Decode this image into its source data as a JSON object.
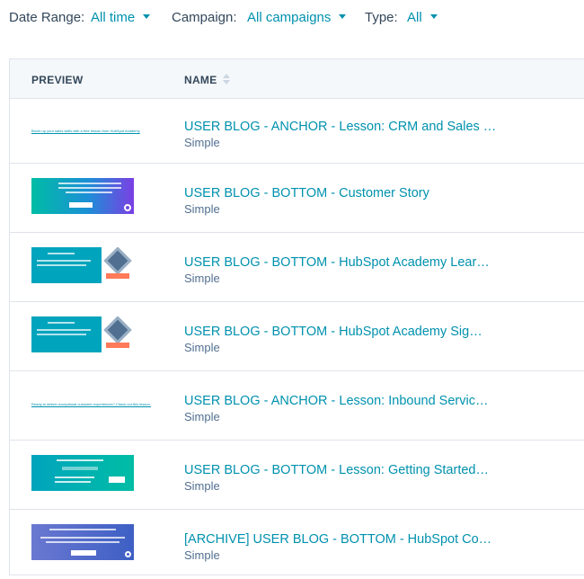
{
  "filters": {
    "date_range": {
      "label": "Date Range:",
      "value": "All time"
    },
    "campaign": {
      "label": "Campaign:",
      "value": "All campaigns"
    },
    "type": {
      "label": "Type:",
      "value": "All"
    }
  },
  "table": {
    "columns": {
      "preview": "PREVIEW",
      "name": "NAME"
    },
    "rows": [
      {
        "name": "USER BLOG - ANCHOR - Lesson: CRM and Sales …",
        "type": "Simple",
        "preview_text": "Brush up your sales skills with a free lesson from HubSpot Academy"
      },
      {
        "name": "USER BLOG - BOTTOM - Customer Story",
        "type": "Simple"
      },
      {
        "name": "USER BLOG - BOTTOM - HubSpot Academy Lear…",
        "type": "Simple"
      },
      {
        "name": "USER BLOG - BOTTOM - HubSpot Academy Sig…",
        "type": "Simple"
      },
      {
        "name": "USER BLOG - ANCHOR - Lesson: Inbound Servic…",
        "type": "Simple",
        "preview_text": "Ready to deliver exceptional customer experiences? Check out this lesson."
      },
      {
        "name": "USER BLOG - BOTTOM - Lesson: Getting Started…",
        "type": "Simple"
      },
      {
        "name": "[ARCHIVE] USER BLOG - BOTTOM - HubSpot Co…",
        "type": "Simple"
      }
    ]
  },
  "colors": {
    "link": "#0091ae",
    "text": "#33475b",
    "header_bg": "#f5f8fa",
    "border": "#dfe3eb"
  },
  "icons": [
    "chevron-down-icon",
    "sort-icon",
    "sprocket-icon"
  ]
}
